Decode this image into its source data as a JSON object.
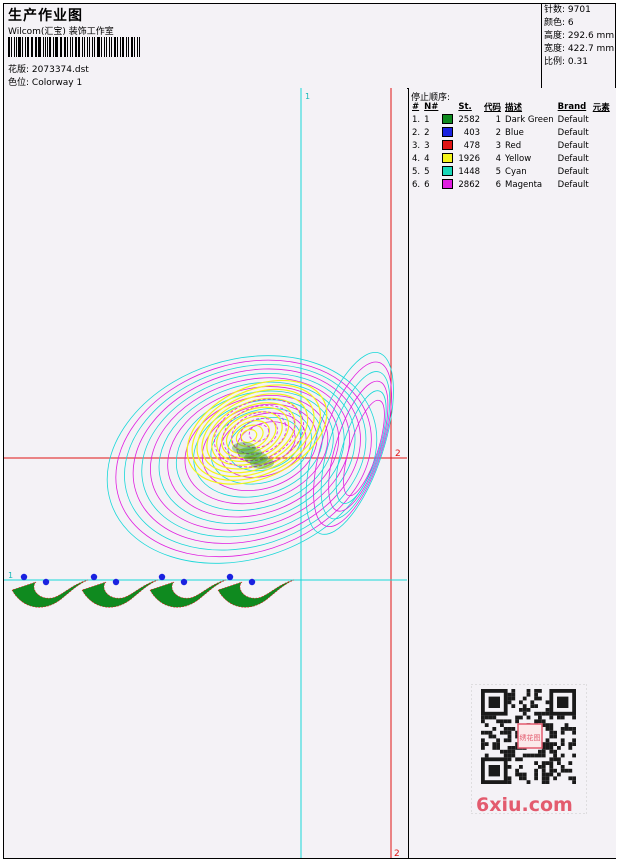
{
  "header": {
    "title": "生产作业图",
    "company": "Wilcom(汇宝) 装饰工作室",
    "design_label": "花版:",
    "design_value": "2073374.dst",
    "colorway_label": "色位:",
    "colorway_value": "Colorway 1"
  },
  "stats": {
    "stitches_label": "针数:",
    "stitches": "9701",
    "colors_label": "颜色:",
    "colors": "6",
    "height_label": "高度:",
    "height": "292.6 mm",
    "width_label": "宽度:",
    "width": "422.7 mm",
    "scale_label": "比例:",
    "scale": "0.31"
  },
  "stop_sequence": {
    "title": "停止顺序:",
    "columns": [
      "#",
      "N#",
      "St.",
      "代码",
      "描述",
      "Brand",
      "元素"
    ],
    "rows": [
      {
        "no": "1.",
        "n": "1",
        "color": "#0f8a1f",
        "st": "2582",
        "code": "1",
        "desc": "Dark Green",
        "brand": "Default"
      },
      {
        "no": "2.",
        "n": "2",
        "color": "#1a22e0",
        "st": "403",
        "code": "2",
        "desc": "Blue",
        "brand": "Default"
      },
      {
        "no": "3.",
        "n": "3",
        "color": "#e01414",
        "st": "478",
        "code": "3",
        "desc": "Red",
        "brand": "Default"
      },
      {
        "no": "4.",
        "n": "4",
        "color": "#f4f41a",
        "st": "1926",
        "code": "4",
        "desc": "Yellow",
        "brand": "Default"
      },
      {
        "no": "5.",
        "n": "5",
        "color": "#19d8b8",
        "st": "1448",
        "code": "5",
        "desc": "Cyan",
        "brand": "Default"
      },
      {
        "no": "6.",
        "n": "6",
        "color": "#e01ee0",
        "st": "2862",
        "code": "6",
        "desc": "Magenta",
        "brand": "Default"
      }
    ]
  },
  "guides": {
    "vline_top_label": "1",
    "vline_bottom_label": "2",
    "hline_left_label": "1",
    "hline_right_label": "2"
  },
  "watermark": {
    "text": "6xiu.com",
    "seal": "绣花图"
  }
}
